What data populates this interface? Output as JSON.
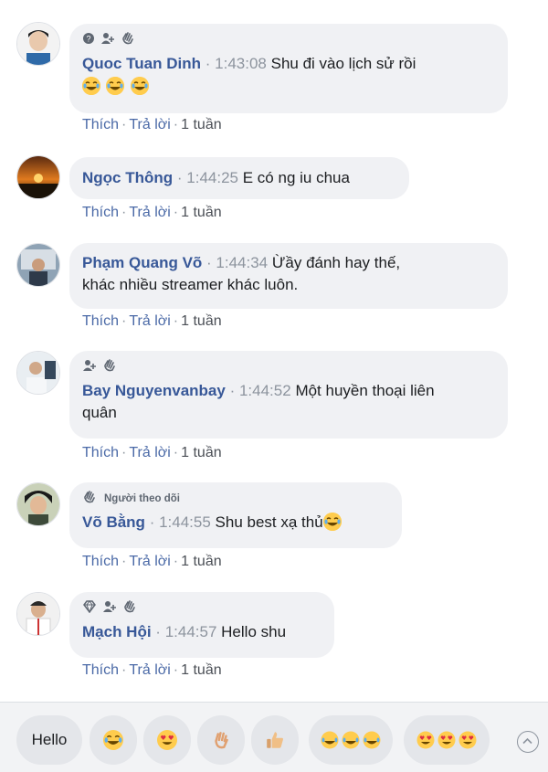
{
  "comments": [
    {
      "name": "Quoc Tuan Dinh",
      "time": "1:43:08",
      "text": "Shu đi vào lịch sử rồi",
      "badges": [
        "question-badge-icon",
        "follower-badge-icon",
        "wave-badge-icon"
      ],
      "badge_text": "",
      "trailing_emojis": [
        "laughing-emoji-icon",
        "laughing-emoji-icon",
        "laughing-emoji-icon"
      ],
      "actions": {
        "like": "Thích",
        "reply": "Trả lời",
        "age": "1 tuần"
      }
    },
    {
      "name": "Ngọc Thông",
      "time": "1:44:25",
      "text": "E có ng iu chua",
      "badges": [],
      "actions": {
        "like": "Thích",
        "reply": "Trả lời",
        "age": "1 tuần"
      }
    },
    {
      "name": "Phạm Quang Võ",
      "time": "1:44:34",
      "text_line1": "Ừầy đánh hay thế,",
      "text_line2": "khác nhiều streamer khác luôn.",
      "badges": [],
      "actions": {
        "like": "Thích",
        "reply": "Trả lời",
        "age": "1 tuần"
      }
    },
    {
      "name": "Bay Nguyenvanbay",
      "time": "1:44:52",
      "text_line1": "Một huyền thoại liên",
      "text_line2": "quân",
      "badges": [
        "follower-badge-icon",
        "wave-badge-icon"
      ],
      "actions": {
        "like": "Thích",
        "reply": "Trả lời",
        "age": "1 tuần"
      }
    },
    {
      "name": "Võ Bằng",
      "time": "1:44:55",
      "text": "Shu best xạ thủ",
      "badges": [
        "wave-badge-icon"
      ],
      "badge_text": "Người theo dõi",
      "trailing_emojis": [
        "laughing-emoji-icon"
      ],
      "actions": {
        "like": "Thích",
        "reply": "Trả lời",
        "age": "1 tuần"
      }
    },
    {
      "name": "Mạch Hội",
      "time": "1:44:57",
      "text": "Hello shu",
      "badges": [
        "diamond-badge-icon",
        "follower-badge-icon",
        "wave-badge-icon"
      ],
      "actions": {
        "like": "Thích",
        "reply": "Trả lời",
        "age": "1 tuần"
      }
    }
  ],
  "quick_replies": {
    "hello": "Hello",
    "items": [
      "laughing-emoji-icon",
      "heart-eyes-emoji-icon",
      "wave-hand-icon",
      "thumbs-up-icon",
      "triple-laughing-emoji-icon",
      "triple-heart-eyes-emoji-icon"
    ]
  },
  "colors": {
    "name": "#385898",
    "bubble": "#f0f1f4",
    "timestamp": "#8d949e",
    "emoji": "#ffcc4d"
  }
}
